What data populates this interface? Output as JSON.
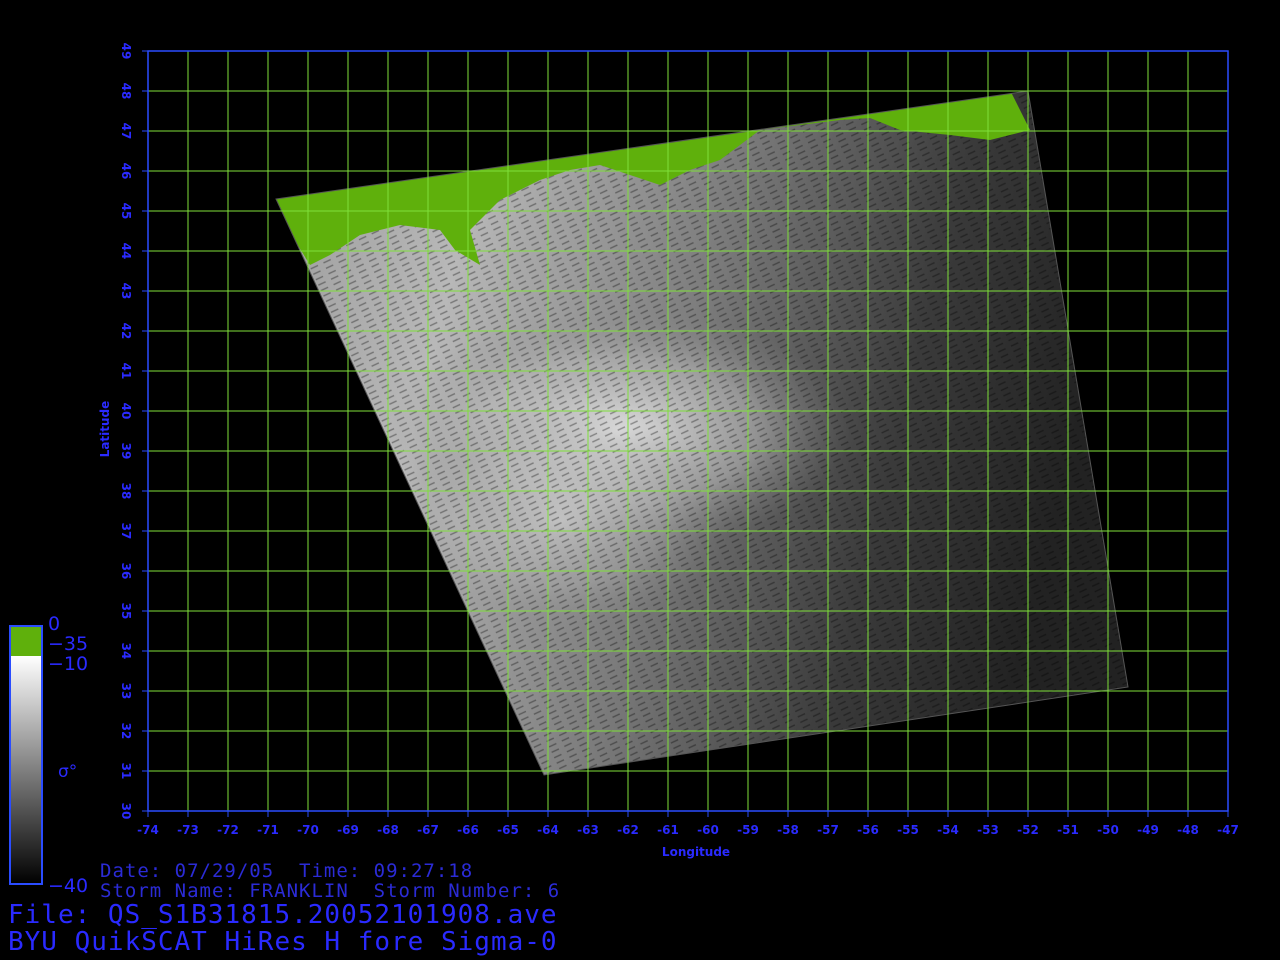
{
  "colors": {
    "frame": "#2a4cff",
    "grid": "#7fe03a",
    "land": "#5fb00c",
    "text": "#2a2aff",
    "background": "#000000"
  },
  "axes": {
    "xlabel": "Longitude",
    "ylabel": "Latitude",
    "lon_range": [
      -74,
      -47
    ],
    "lat_range": [
      30,
      49
    ],
    "lon_ticks": [
      -74,
      -73,
      -72,
      -71,
      -70,
      -69,
      -68,
      -67,
      -66,
      -65,
      -64,
      -63,
      -62,
      -61,
      -60,
      -59,
      -58,
      -57,
      -56,
      -55,
      -54,
      -53,
      -52,
      -51,
      -50,
      -49,
      -48,
      -47
    ],
    "lat_ticks": [
      30,
      31,
      32,
      33,
      34,
      35,
      36,
      37,
      38,
      39,
      40,
      41,
      42,
      43,
      44,
      45,
      46,
      47,
      48,
      49
    ]
  },
  "swath": {
    "corners": [
      [
        -70.8,
        45.3
      ],
      [
        -52.0,
        48.0
      ],
      [
        -49.5,
        33.1
      ],
      [
        -64.1,
        30.9
      ]
    ]
  },
  "colorbar": {
    "symbol": "σ°",
    "labels": {
      "top": "0",
      "land_threshold": "−35",
      "upper": "−10",
      "bottom": "−40"
    }
  },
  "info": {
    "date_line": "Date: 07/29/05  Time: 09:27:18",
    "storm_line": "Storm Name: FRANKLIN  Storm Number: 6",
    "file_line": "File: QS_S1B31815.20052101908.ave",
    "product_line": "BYU QuikSCAT HiRes H fore Sigma-0"
  }
}
